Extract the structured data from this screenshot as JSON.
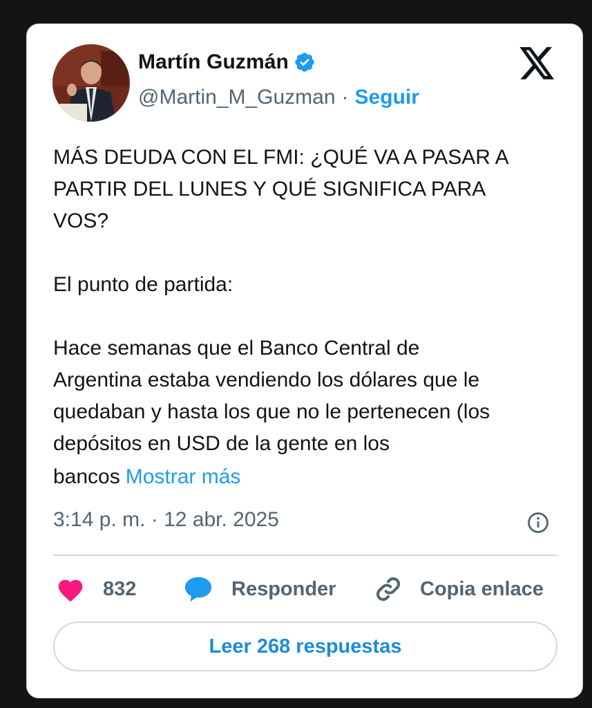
{
  "author": {
    "name": "Martín Guzmán",
    "handle": "@Martin_M_Guzman",
    "separator": "·",
    "follow_label": "Seguir",
    "verified": true
  },
  "tweet": {
    "text": "MÁS DEUDA CON EL FMI: ¿QUÉ VA A PASAR A\nPARTIR DEL LUNES Y QUÉ SIGNIFICA PARA\nVOS?\n\nEl punto de partida:\n\nHace semanas que el Banco Central de\nArgentina estaba vendiendo los dólares que le\nquedaban y hasta los que no le pertenecen (los\ndepósitos en USD de la gente en los",
    "tail": "bancos",
    "show_more": "Mostrar más",
    "timestamp": "3:14 p. m. · 12 abr. 2025"
  },
  "actions": {
    "like_count": "832",
    "reply_label": "Responder",
    "copy_link_label": "Copia enlace"
  },
  "read_replies_label": "Leer 268 respuestas",
  "icons": {
    "platform_logo": "x-logo-icon",
    "verified": "verified-badge-icon",
    "info": "info-icon",
    "like": "heart-icon",
    "reply": "speech-bubble-icon",
    "copy_link": "link-icon"
  },
  "colors": {
    "accent": "#1d9bf0",
    "heart": "#f91880",
    "secondary_text": "#536471",
    "primary_text": "#0f1419"
  }
}
